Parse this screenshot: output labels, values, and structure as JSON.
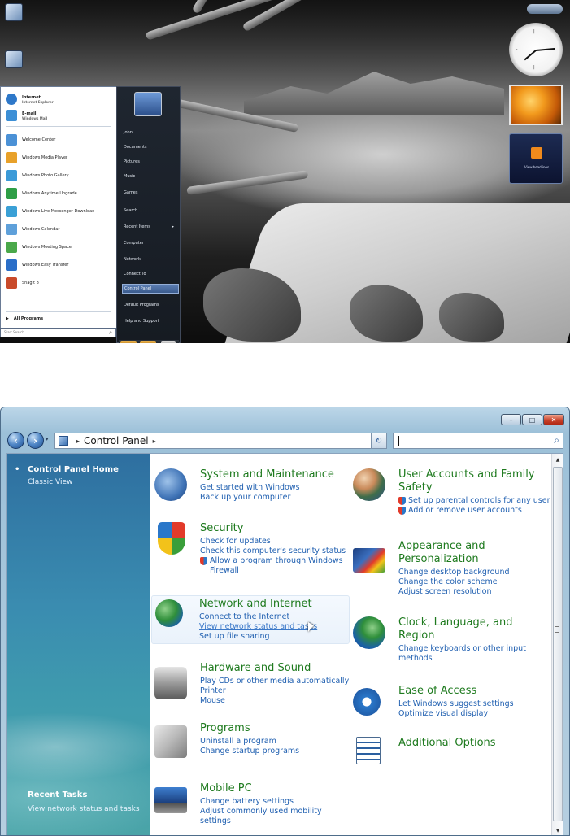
{
  "desktop": {
    "start_menu": {
      "pinned": [
        {
          "label": "Internet",
          "sub": "Internet Explorer",
          "color": "#2e78c9"
        },
        {
          "label": "E-mail",
          "sub": "Windows Mail",
          "color": "#3c8fd6"
        }
      ],
      "recent": [
        {
          "label": "Welcome Center",
          "color": "#4b91d6"
        },
        {
          "label": "Windows Media Player",
          "color": "#e8a12a"
        },
        {
          "label": "Windows Photo Gallery",
          "color": "#3b9ad8"
        },
        {
          "label": "Windows Anytime Upgrade",
          "color": "#2e9e46"
        },
        {
          "label": "Windows Live Messenger Download",
          "color": "#3aa0d6"
        },
        {
          "label": "Windows Calendar",
          "color": "#5ea0da"
        },
        {
          "label": "Windows Meeting Space",
          "color": "#4aa84a"
        },
        {
          "label": "Windows Easy Transfer",
          "color": "#2a6ec8"
        },
        {
          "label": "SnagIt 8",
          "color": "#c94a2a"
        }
      ],
      "all_programs": "All Programs",
      "search_placeholder": "Start Search",
      "right_items": [
        {
          "label": "John"
        },
        {
          "label": "Documents"
        },
        {
          "label": "Pictures"
        },
        {
          "label": "Music"
        },
        {
          "label": "Games"
        },
        {
          "label": "Search"
        },
        {
          "label": "Recent Items",
          "arrow": "▸"
        },
        {
          "label": "Computer"
        },
        {
          "label": "Network"
        },
        {
          "label": "Connect To"
        },
        {
          "label": "Control Panel"
        },
        {
          "label": "Default Programs"
        },
        {
          "label": "Help and Support"
        }
      ]
    },
    "feed_gadget": {
      "label": "View headlines"
    }
  },
  "window": {
    "address": {
      "crumb": "Control Panel",
      "separator_before": "▸",
      "separator_after": "▸",
      "dropdown": "▾",
      "refresh": "↻"
    },
    "search": {
      "value": ""
    },
    "caption": {
      "minimize": "–",
      "maximize": "□",
      "close": "✕"
    },
    "left_pane": {
      "home": "Control Panel Home",
      "classic": "Classic View",
      "recent_title": "Recent Tasks",
      "recent_item": "View network status and tasks"
    },
    "categories": [
      {
        "title": "System and Maintenance",
        "links": [
          "Get started with Windows",
          "Back up your computer"
        ]
      },
      {
        "title": "Security",
        "links": [
          "Check for updates",
          "Check this computer's security status",
          "Allow a program through Windows",
          "Firewall"
        ]
      },
      {
        "title": "Network and Internet",
        "links": [
          "Connect to the Internet",
          "View network status and tasks",
          "Set up file sharing"
        ]
      },
      {
        "title": "Hardware and Sound",
        "links": [
          "Play CDs or other media automatically",
          "Printer",
          "Mouse"
        ]
      },
      {
        "title": "Programs",
        "links": [
          "Uninstall a program",
          "Change startup programs"
        ]
      },
      {
        "title": "Mobile PC",
        "links": [
          "Change battery settings",
          "Adjust commonly used mobility",
          "settings"
        ]
      },
      {
        "title": "User Accounts and Family",
        "title2": "Safety",
        "links": [
          "Set up parental controls for any user",
          "Add or remove user accounts"
        ]
      },
      {
        "title": "Appearance and",
        "title2": "Personalization",
        "links": [
          "Change desktop background",
          "Change the color scheme",
          "Adjust screen resolution"
        ]
      },
      {
        "title": "Clock, Language, and",
        "title2": "Region",
        "links": [
          "Change keyboards or other input",
          "methods"
        ]
      },
      {
        "title": "Ease of Access",
        "links": [
          "Let Windows suggest settings",
          "Optimize visual display"
        ]
      },
      {
        "title": "Additional Options",
        "links": []
      }
    ],
    "colors": {
      "category_title": "#1e7a1e",
      "link": "#1f5fb0",
      "left_pane": "#2e6fa0"
    }
  }
}
